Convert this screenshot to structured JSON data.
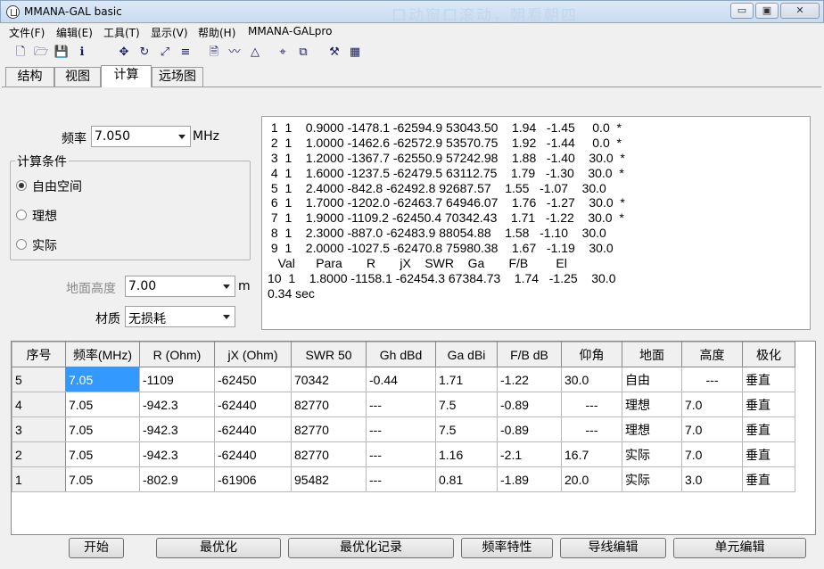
{
  "window": {
    "title": "MMANA-GAL basic",
    "watermark": "口动窗口滚动，朝看朝四",
    "controls": {
      "minimize": "▭",
      "maximize": "▣",
      "close": "✕"
    }
  },
  "menu": [
    "文件(F)",
    "编辑(E)",
    "工具(T)",
    "显示(V)",
    "帮助(H)",
    "MMANA-GALpro"
  ],
  "toolbar": [
    {
      "name": "new-file-icon",
      "glyph": "🗋"
    },
    {
      "name": "open-folder-icon",
      "glyph": "🗁"
    },
    {
      "name": "save-icon",
      "glyph": "💾"
    },
    {
      "name": "info-icon",
      "glyph": "ℹ"
    },
    {
      "name": "move-icon",
      "glyph": "✥"
    },
    {
      "name": "rotate-icon",
      "glyph": "↻"
    },
    {
      "name": "scale-icon",
      "glyph": "⤢"
    },
    {
      "name": "elements-icon",
      "glyph": "≡"
    },
    {
      "name": "document-icon",
      "glyph": "🗎"
    },
    {
      "name": "wire-edit-icon",
      "glyph": "〰"
    },
    {
      "name": "triangle-icon",
      "glyph": "△"
    },
    {
      "name": "target-icon",
      "glyph": "⌖"
    },
    {
      "name": "copy-icon",
      "glyph": "⧉"
    },
    {
      "name": "tools-icon",
      "glyph": "⚒"
    },
    {
      "name": "calculator-icon",
      "glyph": "▦"
    }
  ],
  "tabs": [
    "结构",
    "视图",
    "计算",
    "远场图"
  ],
  "active_tab": "计算",
  "calc": {
    "freq_label": "频率",
    "freq_value": "7.050",
    "freq_unit": "MHz",
    "conditions_title": "计算条件",
    "conditions": [
      {
        "label": "自由空间",
        "checked": true
      },
      {
        "label": "理想",
        "checked": false
      },
      {
        "label": "实际",
        "checked": false
      }
    ],
    "ground_height_label": "地面高度",
    "ground_height_value": "7.00",
    "ground_height_unit": "m",
    "material_label": "材质",
    "material_value": "无损耗"
  },
  "output_lines": [
    " 1  1    0.9000 -1478.1 -62594.9 53043.50    1.94   -1.45     0.0  *",
    " 2  1    1.0000 -1462.6 -62572.9 53570.75    1.92   -1.44     0.0  *",
    " 3  1    1.2000 -1367.7 -62550.9 57242.98    1.88   -1.40    30.0  *",
    " 4  1    1.6000 -1237.5 -62479.5 63112.75    1.79   -1.30    30.0  *",
    " 5  1    2.4000 -842.8 -62492.8 92687.57    1.55   -1.07    30.0",
    " 6  1    1.7000 -1202.0 -62463.7 64946.07    1.76   -1.27    30.0  *",
    " 7  1    1.9000 -1109.2 -62450.4 70342.43    1.71   -1.22    30.0  *",
    " 8  1    2.3000 -887.0 -62483.9 88054.88    1.58   -1.10    30.0",
    " 9  1    2.0000 -1027.5 -62470.8 75980.38    1.67   -1.19    30.0",
    "   Val      Para       R       jX    SWR    Ga       F/B        El",
    "10  1    1.8000 -1158.1 -62454.3 67384.73    1.74   -1.25    30.0",
    "0.34 sec"
  ],
  "results_table": {
    "headers": [
      "序号",
      "频率(MHz)",
      "R (Ohm)",
      "jX (Ohm)",
      "SWR 50",
      "Gh dBd",
      "Ga dBi",
      "F/B dB",
      "仰角",
      "地面",
      "高度",
      "极化"
    ],
    "rows": [
      [
        "5",
        "7.05",
        "-1109",
        "-62450",
        "70342",
        "-0.44",
        "1.71",
        "-1.22",
        "30.0",
        "自由",
        "---",
        "垂直"
      ],
      [
        "4",
        "7.05",
        "-942.3",
        "-62440",
        "82770",
        "---",
        "7.5",
        "-0.89",
        "---",
        "理想",
        "7.0",
        "垂直"
      ],
      [
        "3",
        "7.05",
        "-942.3",
        "-62440",
        "82770",
        "---",
        "7.5",
        "-0.89",
        "---",
        "理想",
        "7.0",
        "垂直"
      ],
      [
        "2",
        "7.05",
        "-942.3",
        "-62440",
        "82770",
        "---",
        "1.16",
        "-2.1",
        "16.7",
        "实际",
        "7.0",
        "垂直"
      ],
      [
        "1",
        "7.05",
        "-802.9",
        "-61906",
        "95482",
        "---",
        "0.81",
        "-1.89",
        "20.0",
        "实际",
        "3.0",
        "垂直"
      ]
    ],
    "selected_cell": {
      "row": 0,
      "col": 1
    }
  },
  "buttons": [
    "开始",
    "最优化",
    "最优化记录",
    "频率特性",
    "导线编辑",
    "单元编辑"
  ],
  "colors": {
    "selection": "#3399ff",
    "window_bg": "#f0f0f0"
  }
}
